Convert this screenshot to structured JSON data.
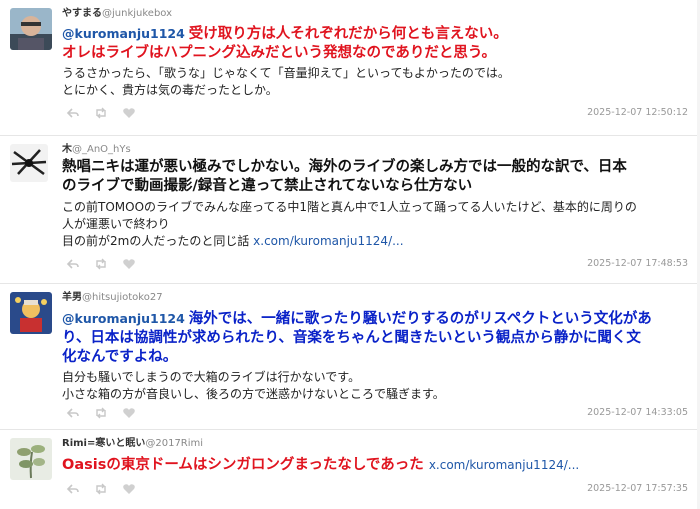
{
  "tweets": [
    {
      "name": "やすまる",
      "handle": "@junkjukebox",
      "mention": "@kuromanju1124",
      "big_lines": [
        "受け取り方は人それぞれだから何とも言えない。",
        "オレはライブはハプニング込みだという発想なのでありだと思う。"
      ],
      "small_lines": [
        "うるさかったら、「歌うな」じゃなくて「音量抑えて」といってもよかったのでは。",
        "とにかく、貴方は気の毒だったとしか。"
      ],
      "timestamp": "2025-12-07 12:50:12"
    },
    {
      "name": "木",
      "handle": "@_AnO_hYs",
      "big_lines": [
        "熱唱ニキは運が悪い極みでしかない。海外のライブの楽しみ方では一般的な訳で、日本",
        "のライブで動画撮影/録音と違って禁止されてないなら仕方ない"
      ],
      "small_lines": [
        "この前TOMOOのライブでみんな座ってる中1階と真ん中で1人立って踊ってる人いたけど、基本的に周りの",
        "人が運悪いで終わり",
        "目の前が2mの人だったのと同じ話"
      ],
      "link": "x.com/kuromanju1124/...",
      "timestamp": "2025-12-07 17:48:53"
    },
    {
      "name": "羊男",
      "handle": "@hitsujiotoko27",
      "mention": "@kuromanju1124",
      "big_lines": [
        "海外では、一緒に歌ったり騒いだりするのがリスペクトという文化があ",
        "り、日本は協調性が求められたり、音楽をちゃんと聞きたいという観点から静かに聞く文",
        "化なんですよね。"
      ],
      "small_lines": [
        "自分も騒いでしまうので大箱のライブは行かないです。",
        "小さな箱の方が音良いし、後ろの方で迷惑かけないところで騒ぎます。"
      ],
      "timestamp": "2025-12-07 14:33:05"
    },
    {
      "name": "Rimi=寒いと眠い",
      "handle": "@2017Rimi",
      "big_lines": [
        "Oasisの東京ドームはシンガロングまったなしであった"
      ],
      "link": "x.com/kuromanju1124/...",
      "timestamp": "2025-12-07 17:57:35"
    }
  ],
  "icons": [
    "reply-icon",
    "retweet-icon",
    "like-icon"
  ],
  "colors": {
    "red_text": "#e0141f",
    "blue_text": "#0a22c8",
    "link": "#1f57a8",
    "timestamp": "#999999"
  }
}
